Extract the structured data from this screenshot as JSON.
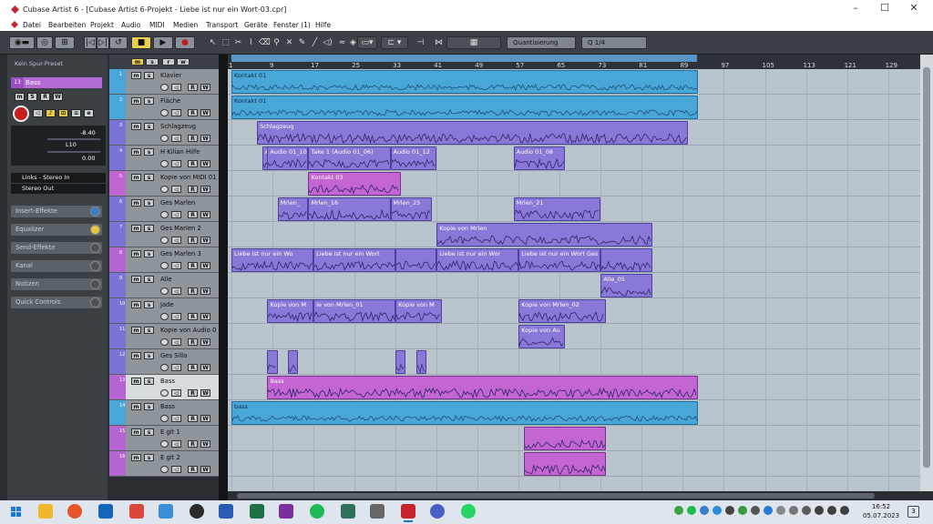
{
  "window": {
    "title": "Cubase Artist 6 - [Cubase Artist 6-Projekt - Liebe ist nur ein Wort-03.cpr]",
    "controls": [
      "–",
      "☐",
      "✕"
    ]
  },
  "menu": [
    "Datei",
    "Bearbeiten",
    "Projekt",
    "Audio",
    "MIDI",
    "Medien",
    "Transport",
    "Geräte",
    "Fenster (1)",
    "Hilfe"
  ],
  "toolbar": {
    "quantize_label": "Quantisierung",
    "quantize_value": "1/4"
  },
  "inspector": {
    "preset": "Kein Spur-Preset",
    "track_number": "13",
    "track_name": "Bass",
    "buttons": [
      "m",
      "S",
      "R",
      "W"
    ],
    "volume_value": "-8.40",
    "pan_label": "L10",
    "delay_value": "0.00",
    "input_routing": "Links - Stereo In",
    "output_routing": "Stereo Out",
    "sections": [
      "Insert-Effekte",
      "Equalizer",
      "Send-Effekte",
      "Kanal",
      "Notizen",
      "Quick Controls"
    ]
  },
  "tracks": [
    {
      "num": "1",
      "name": "Klavier",
      "color": "#4aa6d9"
    },
    {
      "num": "2",
      "name": "Fläche",
      "color": "#4aa6d9"
    },
    {
      "num": "3",
      "name": "Schlagzeug",
      "color": "#7a74d6"
    },
    {
      "num": "4",
      "name": "H Kilian Hilfe",
      "color": "#7a74d6"
    },
    {
      "num": "5",
      "name": "Kopie von MIDI 01",
      "color": "#c066d0"
    },
    {
      "num": "6",
      "name": "Ges Marlen",
      "color": "#7a74d6"
    },
    {
      "num": "7",
      "name": "Ges Marlen 2",
      "color": "#7a74d6"
    },
    {
      "num": "8",
      "name": "Ges Marlen 3",
      "color": "#b465d2"
    },
    {
      "num": "9",
      "name": "Alle",
      "color": "#7a74d6"
    },
    {
      "num": "10",
      "name": "Jade",
      "color": "#7a74d6"
    },
    {
      "num": "11",
      "name": "Kopie von Audio 0",
      "color": "#7a74d6"
    },
    {
      "num": "12",
      "name": "Ges Silla",
      "color": "#7a74d6"
    },
    {
      "num": "13",
      "name": "Bass",
      "color": "#b465d2"
    },
    {
      "num": "14",
      "name": "Bass",
      "color": "#4aa6d9"
    },
    {
      "num": "15",
      "name": "E git 1",
      "color": "#b465d2"
    },
    {
      "num": "16",
      "name": "E git 2",
      "color": "#b465d2"
    }
  ],
  "ruler_ticks": [
    "1",
    "9",
    "17",
    "25",
    "33",
    "41",
    "49",
    "57",
    "65",
    "73",
    "81",
    "89",
    "97",
    "105",
    "113",
    "121",
    "129"
  ],
  "events": [
    {
      "track": 0,
      "start": 1,
      "end": 92,
      "label": "Kontakt 01",
      "kind": "blue"
    },
    {
      "track": 1,
      "start": 1,
      "end": 92,
      "label": "Kontakt 01",
      "kind": "blue"
    },
    {
      "track": 2,
      "start": 6,
      "end": 90,
      "label": "Schlagzeug",
      "kind": "purple"
    },
    {
      "track": 3,
      "start": 7,
      "end": 8,
      "label": "A",
      "kind": "purple"
    },
    {
      "track": 3,
      "start": 8,
      "end": 16,
      "label": "Audio 01_10",
      "kind": "purple"
    },
    {
      "track": 3,
      "start": 16,
      "end": 32,
      "label": "Take 1 (Audio 01_06)",
      "kind": "purple"
    },
    {
      "track": 3,
      "start": 32,
      "end": 41,
      "label": "Audio 01_12",
      "kind": "purple"
    },
    {
      "track": 3,
      "start": 56,
      "end": 66,
      "label": "Audio 01_08",
      "kind": "purple"
    },
    {
      "track": 4,
      "start": 16,
      "end": 34,
      "label": "Kontakt 03",
      "kind": "magenta"
    },
    {
      "track": 5,
      "start": 10,
      "end": 16,
      "label": "Mrlen_",
      "kind": "purple"
    },
    {
      "track": 5,
      "start": 16,
      "end": 32,
      "label": "Mrlen_16",
      "kind": "purple"
    },
    {
      "track": 5,
      "start": 32,
      "end": 40,
      "label": "Mrlen_25",
      "kind": "purple"
    },
    {
      "track": 5,
      "start": 56,
      "end": 73,
      "label": "Mrlen_21",
      "kind": "purple"
    },
    {
      "track": 6,
      "start": 41,
      "end": 83,
      "label": "Kopie von Mrlen",
      "kind": "purple"
    },
    {
      "track": 7,
      "start": 1,
      "end": 17,
      "label": "Liebe ist nur ein Wo",
      "kind": "purple"
    },
    {
      "track": 7,
      "start": 17,
      "end": 33,
      "label": "Liebe ist nur ein Wort",
      "kind": "purple"
    },
    {
      "track": 7,
      "start": 33,
      "end": 41,
      "label": "",
      "kind": "purple"
    },
    {
      "track": 7,
      "start": 41,
      "end": 57,
      "label": "Liebe ist nur ein Wor",
      "kind": "purple"
    },
    {
      "track": 7,
      "start": 57,
      "end": 73,
      "label": "Liebe ist nur ein Wort Ges M",
      "kind": "purple"
    },
    {
      "track": 7,
      "start": 73,
      "end": 83,
      "label": "",
      "kind": "purple"
    },
    {
      "track": 8,
      "start": 73,
      "end": 83,
      "label": "Alle_05",
      "kind": "purple"
    },
    {
      "track": 9,
      "start": 8,
      "end": 17,
      "label": "Kopie von M",
      "kind": "purple"
    },
    {
      "track": 9,
      "start": 17,
      "end": 33,
      "label": "ie von Mrlen_01",
      "kind": "purple"
    },
    {
      "track": 9,
      "start": 33,
      "end": 42,
      "label": "Kopie von M",
      "kind": "purple"
    },
    {
      "track": 9,
      "start": 57,
      "end": 74,
      "label": "Kopie von Mrlen_02",
      "kind": "purple"
    },
    {
      "track": 10,
      "start": 57,
      "end": 66,
      "label": "Kopie von Au",
      "kind": "purple"
    },
    {
      "track": 11,
      "start": 8,
      "end": 10,
      "label": "",
      "kind": "purple"
    },
    {
      "track": 11,
      "start": 12,
      "end": 14,
      "label": "",
      "kind": "purple"
    },
    {
      "track": 11,
      "start": 33,
      "end": 35,
      "label": "",
      "kind": "purple"
    },
    {
      "track": 11,
      "start": 37,
      "end": 39,
      "label": "",
      "kind": "purple"
    },
    {
      "track": 12,
      "start": 8,
      "end": 92,
      "label": "Bass",
      "kind": "magenta"
    },
    {
      "track": 13,
      "start": 1,
      "end": 92,
      "label": "bass",
      "kind": "blue"
    },
    {
      "track": 14,
      "start": 58,
      "end": 74,
      "label": "",
      "kind": "magenta"
    },
    {
      "track": 15,
      "start": 58,
      "end": 74,
      "label": "",
      "kind": "magenta"
    }
  ],
  "taskbar": {
    "time": "16:52",
    "date": "05.07.2023",
    "notifications": "3"
  }
}
